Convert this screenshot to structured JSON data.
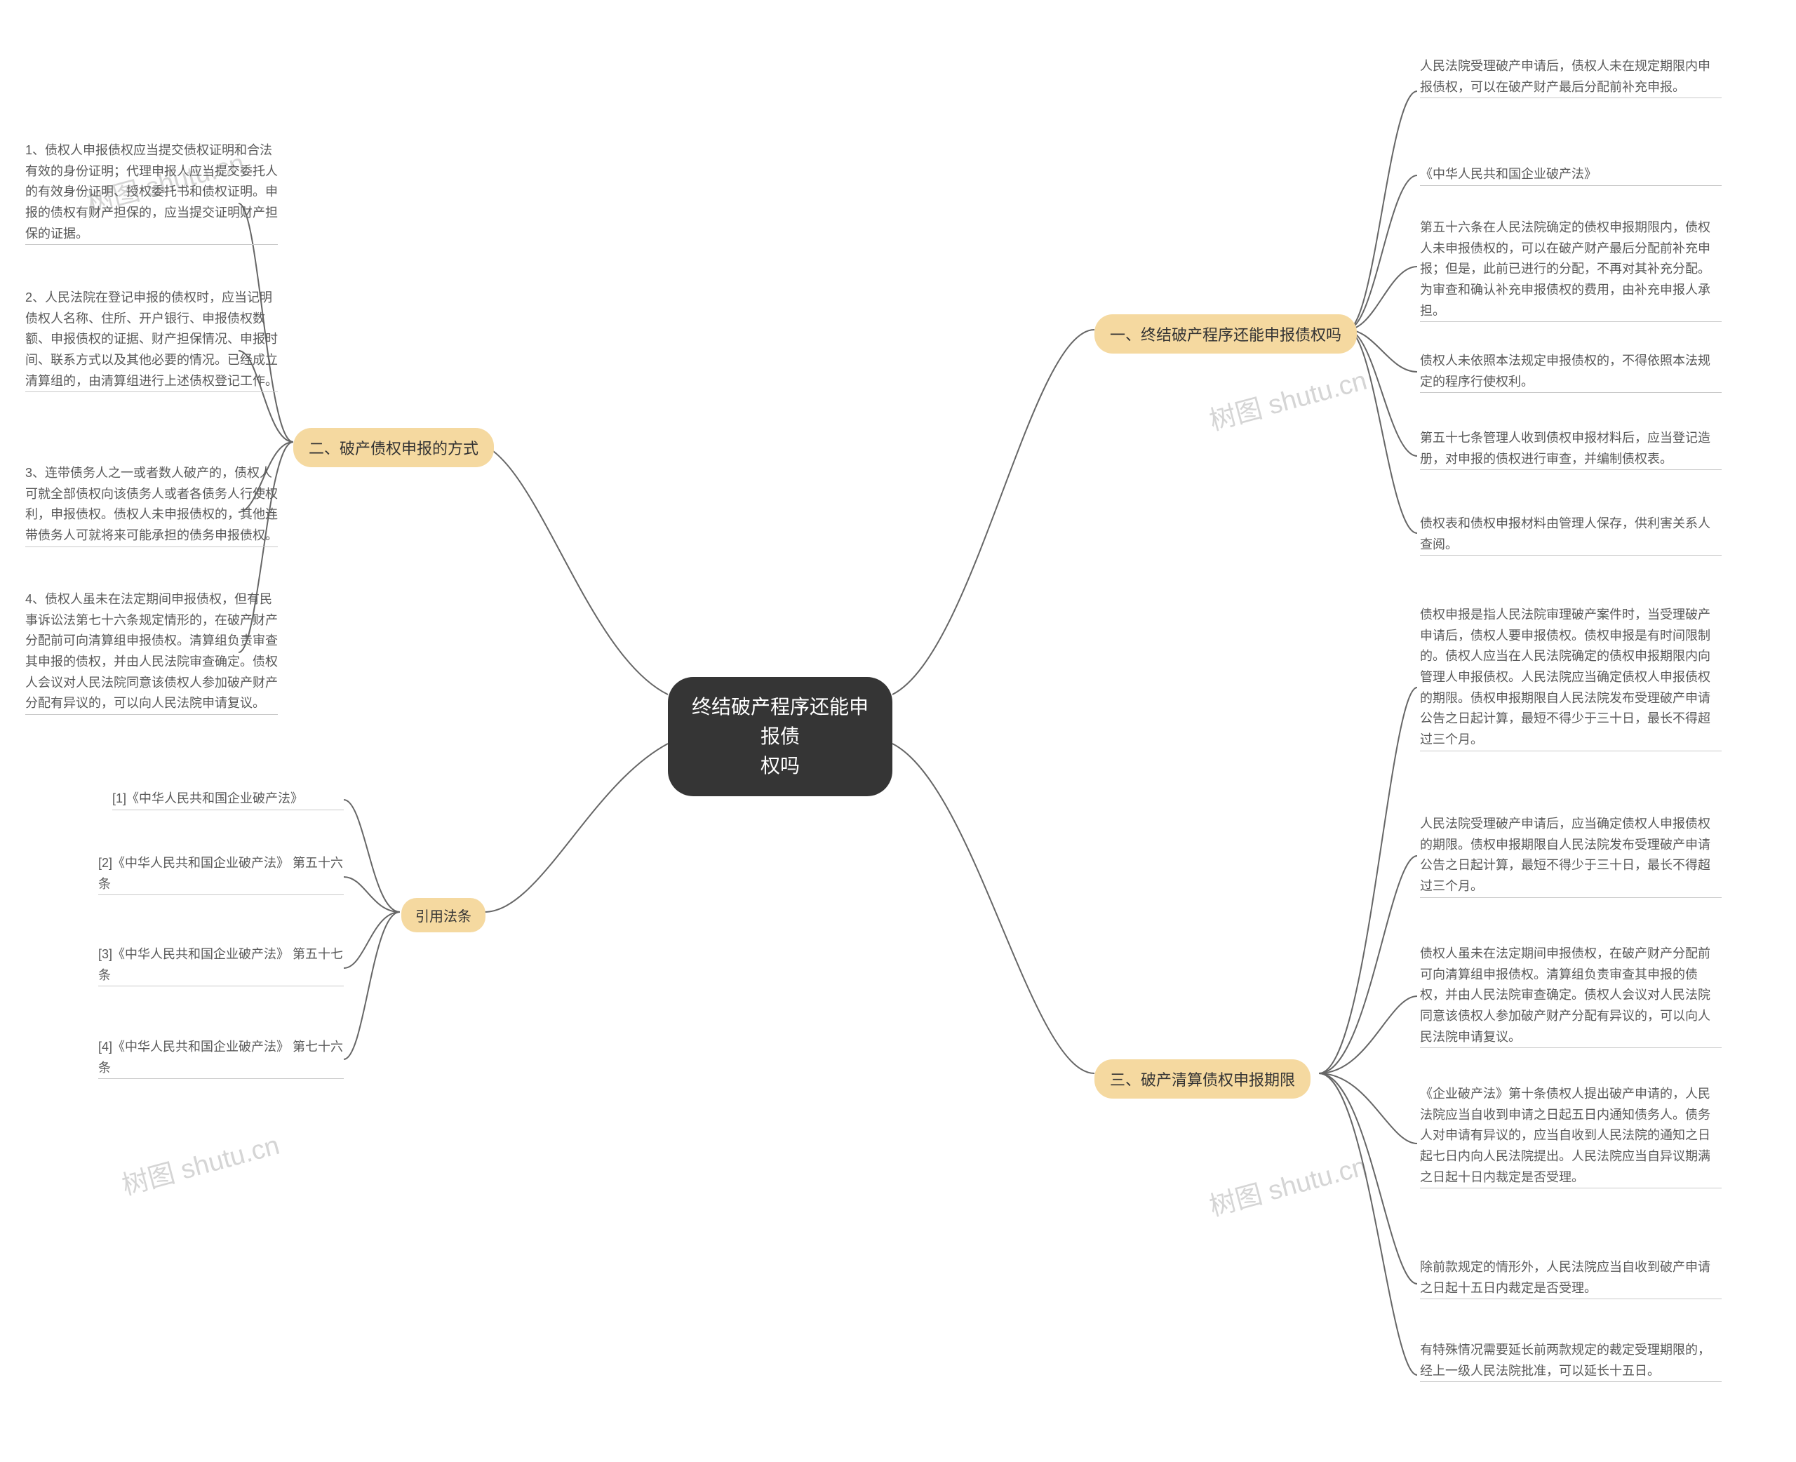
{
  "center": {
    "title_line1": "终结破产程序还能申报债",
    "title_line2": "权吗"
  },
  "branches": {
    "one": {
      "label": "一、终结破产程序还能申报债权吗",
      "leaves": [
        "人民法院受理破产申请后，债权人未在规定期限内申报债权，可以在破产财产最后分配前补充申报。",
        "《中华人民共和国企业破产法》",
        "第五十六条在人民法院确定的债权申报期限内，债权人未申报债权的，可以在破产财产最后分配前补充申报；但是，此前已进行的分配，不再对其补充分配。为审查和确认补充申报债权的费用，由补充申报人承担。",
        "债权人未依照本法规定申报债权的，不得依照本法规定的程序行使权利。",
        "第五十七条管理人收到债权申报材料后，应当登记造册，对申报的债权进行审查，并编制债权表。",
        "债权表和债权申报材料由管理人保存，供利害关系人查阅。"
      ]
    },
    "two": {
      "label": "二、破产债权申报的方式",
      "leaves": [
        "1、债权人申报债权应当提交债权证明和合法有效的身份证明；代理申报人应当提交委托人的有效身份证明、授权委托书和债权证明。申报的债权有财产担保的，应当提交证明财产担保的证据。",
        "2、人民法院在登记申报的债权时，应当记明债权人名称、住所、开户银行、申报债权数额、申报债权的证据、财产担保情况、申报时间、联系方式以及其他必要的情况。已经成立清算组的，由清算组进行上述债权登记工作。",
        "3、连带债务人之一或者数人破产的，债权人可就全部债权向该债务人或者各债务人行使权利，申报债权。债权人未申报债权的，其他连带债务人可就将来可能承担的债务申报债权。",
        "4、债权人虽未在法定期间申报债权，但有民事诉讼法第七十六条规定情形的，在破产财产分配前可向清算组申报债权。清算组负责审查其申报的债权，并由人民法院审查确定。债权人会议对人民法院同意该债权人参加破产财产分配有异议的，可以向人民法院申请复议。"
      ]
    },
    "three": {
      "label": "三、破产清算债权申报期限",
      "leaves": [
        "债权申报是指人民法院审理破产案件时，当受理破产申请后，债权人要申报债权。债权申报是有时间限制的。债权人应当在人民法院确定的债权申报期限内向管理人申报债权。人民法院应当确定债权人申报债权的期限。债权申报期限自人民法院发布受理破产申请公告之日起计算，最短不得少于三十日，最长不得超过三个月。",
        "人民法院受理破产申请后，应当确定债权人申报债权的期限。债权申报期限自人民法院发布受理破产申请公告之日起计算，最短不得少于三十日，最长不得超过三个月。",
        "债权人虽未在法定期间申报债权，在破产财产分配前可向清算组申报债权。清算组负责审查其申报的债权，并由人民法院审查确定。债权人会议对人民法院同意该债权人参加破产财产分配有异议的，可以向人民法院申请复议。",
        "《企业破产法》第十条债权人提出破产申请的，人民法院应当自收到申请之日起五日内通知债务人。债务人对申请有异议的，应当自收到人民法院的通知之日起七日内向人民法院提出。人民法院应当自异议期满之日起十日内裁定是否受理。",
        "除前款规定的情形外，人民法院应当自收到破产申请之日起十五日内裁定是否受理。",
        "有特殊情况需要延长前两款规定的裁定受理期限的，经上一级人民法院批准，可以延长十五日。"
      ]
    },
    "ref": {
      "label": "引用法条",
      "leaves": [
        "[1]《中华人民共和国企业破产法》",
        "[2]《中华人民共和国企业破产法》 第五十六条",
        "[3]《中华人民共和国企业破产法》 第五十七条",
        "[4]《中华人民共和国企业破产法》 第七十六条"
      ]
    }
  },
  "watermarks": [
    "树图 shutu.cn",
    "树图 shutu.cn",
    "树图 shutu.cn",
    "树图 shutu.cn"
  ]
}
